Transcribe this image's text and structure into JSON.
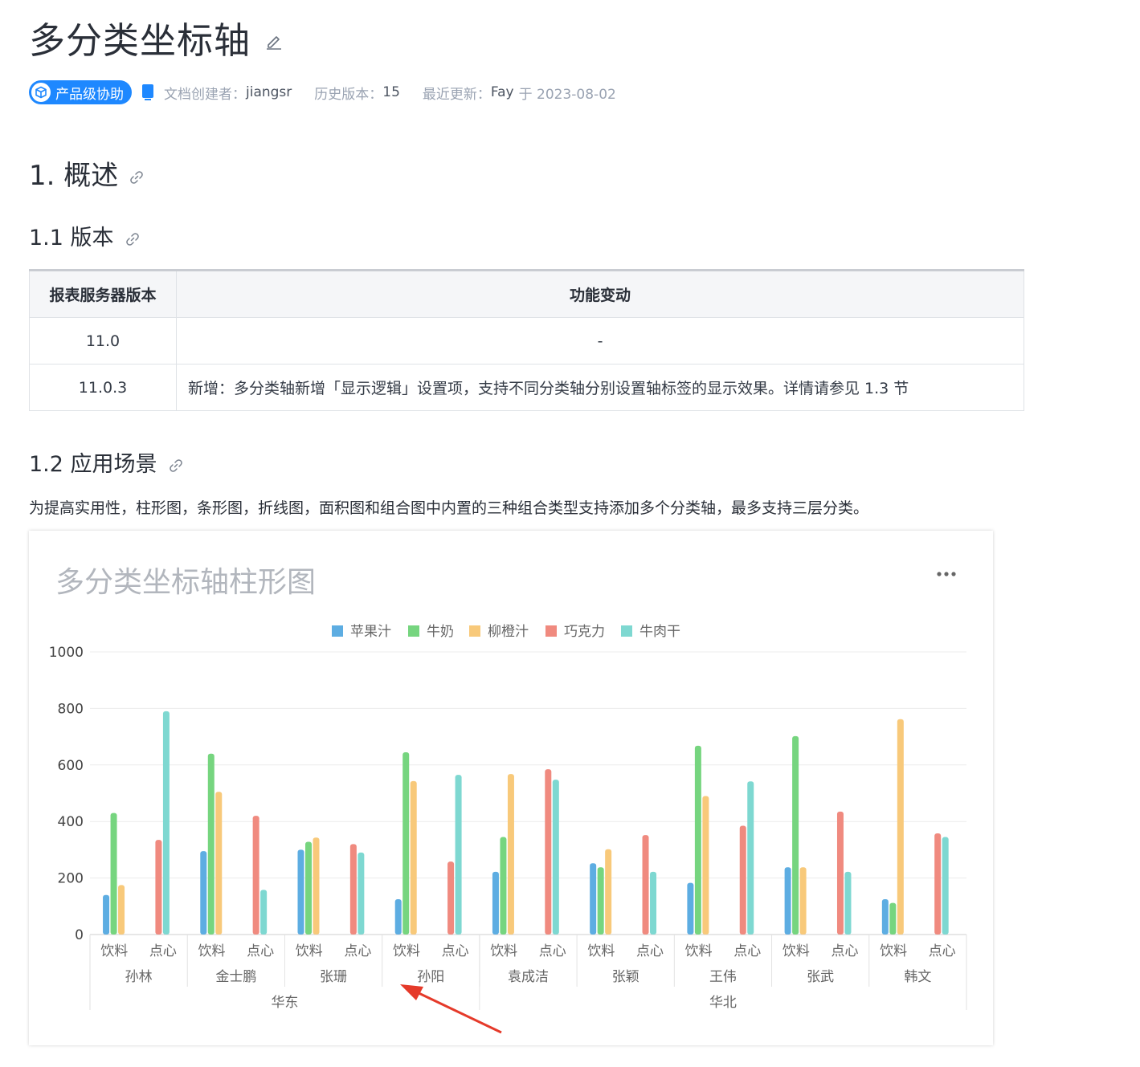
{
  "doc": {
    "title": "多分类坐标轴",
    "badge_label": "产品级协助",
    "creator_label": "文档创建者：",
    "creator": "jiangsr",
    "history_label": "历史版本：",
    "history_count": "15",
    "updated_label": "最近更新：",
    "updated_by": "Fay",
    "updated_at": "于 2023-08-02"
  },
  "sections": {
    "overview": "1. 概述",
    "version": "1.1 版本",
    "scenario": "1.2 应用场景"
  },
  "version_table": {
    "headers": [
      "报表服务器版本",
      "功能变动"
    ],
    "rows": [
      [
        "11.0",
        "-"
      ],
      [
        "11.0.3",
        "新增：多分类轴新增「显示逻辑」设置项，支持不同分类轴分别设置轴标签的显示效果。详情请参见 1.3 节"
      ]
    ]
  },
  "scenario_text": "为提高实用性，柱形图，条形图，折线图，面积图和组合图中内置的三种组合类型支持添加多个分类轴，最多支持三层分类。",
  "chart_data": {
    "type": "bar",
    "title": "多分类坐标轴柱形图",
    "menu_icon": "more-icon",
    "ylim": [
      0,
      1000
    ],
    "yticks": [
      0,
      200,
      400,
      600,
      800,
      1000
    ],
    "grid": true,
    "legend_position": "top",
    "series": [
      {
        "name": "苹果汁",
        "color": "#5dade2"
      },
      {
        "name": "牛奶",
        "color": "#76d57f"
      },
      {
        "name": "柳橙汁",
        "color": "#f8c97a"
      },
      {
        "name": "巧克力",
        "color": "#f08a7f"
      },
      {
        "name": "牛肉干",
        "color": "#7ed8d1"
      }
    ],
    "regions": [
      {
        "name": "华东",
        "persons": [
          {
            "name": "孙林",
            "groups": [
              {
                "name": "饮料",
                "values": [
                  140,
                  430,
                  175,
                  null,
                  null
                ]
              },
              {
                "name": "点心",
                "values": [
                  null,
                  null,
                  null,
                  335,
                  790
                ]
              }
            ]
          },
          {
            "name": "金士鹏",
            "groups": [
              {
                "name": "饮料",
                "values": [
                  295,
                  640,
                  505,
                  null,
                  null
                ]
              },
              {
                "name": "点心",
                "values": [
                  null,
                  null,
                  null,
                  420,
                  158
                ]
              }
            ]
          },
          {
            "name": "张珊",
            "groups": [
              {
                "name": "饮料",
                "values": [
                  300,
                  328,
                  343,
                  null,
                  null
                ]
              },
              {
                "name": "点心",
                "values": [
                  null,
                  null,
                  null,
                  320,
                  290
                ]
              }
            ]
          },
          {
            "name": "孙阳",
            "groups": [
              {
                "name": "饮料",
                "values": [
                  125,
                  645,
                  543,
                  null,
                  null
                ]
              },
              {
                "name": "点心",
                "values": [
                  null,
                  null,
                  null,
                  258,
                  565
                ]
              }
            ]
          }
        ]
      },
      {
        "name": "华北",
        "persons": [
          {
            "name": "袁成洁",
            "groups": [
              {
                "name": "饮料",
                "values": [
                  222,
                  345,
                  568,
                  null,
                  null
                ]
              },
              {
                "name": "点心",
                "values": [
                  null,
                  null,
                  null,
                  585,
                  548
                ]
              }
            ]
          },
          {
            "name": "张颖",
            "groups": [
              {
                "name": "饮料",
                "values": [
                  252,
                  238,
                  302,
                  null,
                  null
                ]
              },
              {
                "name": "点心",
                "values": [
                  null,
                  null,
                  null,
                  352,
                  222
                ]
              }
            ]
          },
          {
            "name": "王伟",
            "groups": [
              {
                "name": "饮料",
                "values": [
                  183,
                  668,
                  490,
                  null,
                  null
                ]
              },
              {
                "name": "点心",
                "values": [
                  null,
                  null,
                  null,
                  385,
                  542
                ]
              }
            ]
          },
          {
            "name": "张武",
            "groups": [
              {
                "name": "饮料",
                "values": [
                  238,
                  702,
                  238,
                  null,
                  null
                ]
              },
              {
                "name": "点心",
                "values": [
                  null,
                  null,
                  null,
                  435,
                  222
                ]
              }
            ]
          },
          {
            "name": "韩文",
            "groups": [
              {
                "name": "饮料",
                "values": [
                  125,
                  112,
                  762,
                  null,
                  null
                ]
              },
              {
                "name": "点心",
                "values": [
                  null,
                  null,
                  null,
                  358,
                  345
                ]
              }
            ]
          }
        ]
      }
    ]
  }
}
